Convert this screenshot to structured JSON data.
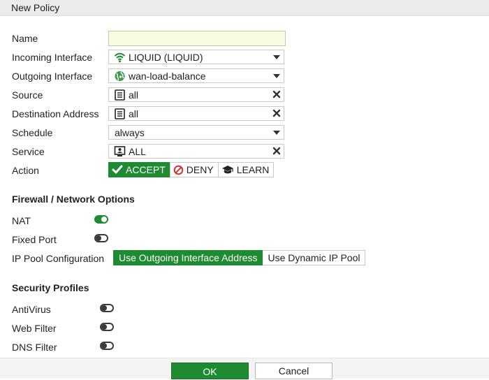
{
  "window": {
    "title": "New Policy"
  },
  "form": {
    "name": {
      "label": "Name",
      "value": ""
    },
    "incoming_interface": {
      "label": "Incoming Interface",
      "value": "LIQUID (LIQUID)",
      "icon": "wifi-icon"
    },
    "outgoing_interface": {
      "label": "Outgoing Interface",
      "value": "wan-load-balance",
      "icon": "globe-icon"
    },
    "source": {
      "label": "Source",
      "value": "all",
      "icon": "address-list-icon"
    },
    "destination": {
      "label": "Destination Address",
      "value": "all",
      "icon": "address-list-icon"
    },
    "schedule": {
      "label": "Schedule",
      "value": "always"
    },
    "service": {
      "label": "Service",
      "value": "ALL",
      "icon": "service-monitor-icon"
    },
    "action": {
      "label": "Action",
      "options": [
        {
          "label": "ACCEPT",
          "icon": "checkmark-icon",
          "selected": true
        },
        {
          "label": "DENY",
          "icon": "deny-icon",
          "selected": false
        },
        {
          "label": "LEARN",
          "icon": "graduation-cap-icon",
          "selected": false
        }
      ]
    }
  },
  "firewall": {
    "title": "Firewall / Network Options",
    "nat": {
      "label": "NAT",
      "enabled": true
    },
    "fixed_port": {
      "label": "Fixed Port",
      "enabled": false
    },
    "ip_pool": {
      "label": "IP Pool Configuration",
      "options": [
        "Use Outgoing Interface Address",
        "Use Dynamic IP Pool"
      ],
      "selected": "Use Outgoing Interface Address"
    }
  },
  "security": {
    "title": "Security Profiles",
    "antivirus": {
      "label": "AntiVirus",
      "enabled": false
    },
    "web_filter": {
      "label": "Web Filter",
      "enabled": false
    },
    "dns_filter": {
      "label": "DNS Filter",
      "enabled": false
    }
  },
  "footer": {
    "ok": "OK",
    "cancel": "Cancel"
  },
  "colors": {
    "accent": "#1e8a32",
    "name_input_bg": "#fafbe3",
    "title_bar": "#ebebeb"
  }
}
